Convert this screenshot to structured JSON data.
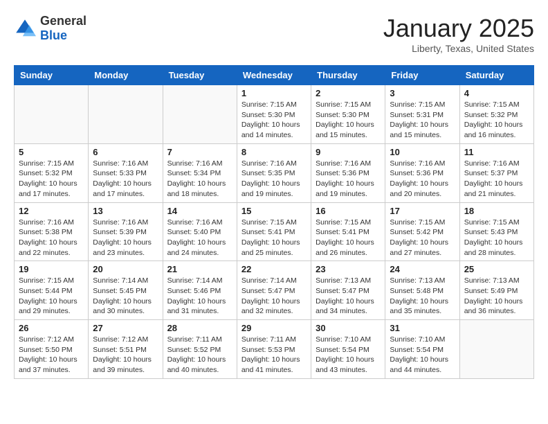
{
  "logo": {
    "general": "General",
    "blue": "Blue"
  },
  "header": {
    "month": "January 2025",
    "location": "Liberty, Texas, United States"
  },
  "weekdays": [
    "Sunday",
    "Monday",
    "Tuesday",
    "Wednesday",
    "Thursday",
    "Friday",
    "Saturday"
  ],
  "weeks": [
    [
      {
        "day": "",
        "info": ""
      },
      {
        "day": "",
        "info": ""
      },
      {
        "day": "",
        "info": ""
      },
      {
        "day": "1",
        "info": "Sunrise: 7:15 AM\nSunset: 5:30 PM\nDaylight: 10 hours\nand 14 minutes."
      },
      {
        "day": "2",
        "info": "Sunrise: 7:15 AM\nSunset: 5:30 PM\nDaylight: 10 hours\nand 15 minutes."
      },
      {
        "day": "3",
        "info": "Sunrise: 7:15 AM\nSunset: 5:31 PM\nDaylight: 10 hours\nand 15 minutes."
      },
      {
        "day": "4",
        "info": "Sunrise: 7:15 AM\nSunset: 5:32 PM\nDaylight: 10 hours\nand 16 minutes."
      }
    ],
    [
      {
        "day": "5",
        "info": "Sunrise: 7:15 AM\nSunset: 5:32 PM\nDaylight: 10 hours\nand 17 minutes."
      },
      {
        "day": "6",
        "info": "Sunrise: 7:16 AM\nSunset: 5:33 PM\nDaylight: 10 hours\nand 17 minutes."
      },
      {
        "day": "7",
        "info": "Sunrise: 7:16 AM\nSunset: 5:34 PM\nDaylight: 10 hours\nand 18 minutes."
      },
      {
        "day": "8",
        "info": "Sunrise: 7:16 AM\nSunset: 5:35 PM\nDaylight: 10 hours\nand 19 minutes."
      },
      {
        "day": "9",
        "info": "Sunrise: 7:16 AM\nSunset: 5:36 PM\nDaylight: 10 hours\nand 19 minutes."
      },
      {
        "day": "10",
        "info": "Sunrise: 7:16 AM\nSunset: 5:36 PM\nDaylight: 10 hours\nand 20 minutes."
      },
      {
        "day": "11",
        "info": "Sunrise: 7:16 AM\nSunset: 5:37 PM\nDaylight: 10 hours\nand 21 minutes."
      }
    ],
    [
      {
        "day": "12",
        "info": "Sunrise: 7:16 AM\nSunset: 5:38 PM\nDaylight: 10 hours\nand 22 minutes."
      },
      {
        "day": "13",
        "info": "Sunrise: 7:16 AM\nSunset: 5:39 PM\nDaylight: 10 hours\nand 23 minutes."
      },
      {
        "day": "14",
        "info": "Sunrise: 7:16 AM\nSunset: 5:40 PM\nDaylight: 10 hours\nand 24 minutes."
      },
      {
        "day": "15",
        "info": "Sunrise: 7:15 AM\nSunset: 5:41 PM\nDaylight: 10 hours\nand 25 minutes."
      },
      {
        "day": "16",
        "info": "Sunrise: 7:15 AM\nSunset: 5:41 PM\nDaylight: 10 hours\nand 26 minutes."
      },
      {
        "day": "17",
        "info": "Sunrise: 7:15 AM\nSunset: 5:42 PM\nDaylight: 10 hours\nand 27 minutes."
      },
      {
        "day": "18",
        "info": "Sunrise: 7:15 AM\nSunset: 5:43 PM\nDaylight: 10 hours\nand 28 minutes."
      }
    ],
    [
      {
        "day": "19",
        "info": "Sunrise: 7:15 AM\nSunset: 5:44 PM\nDaylight: 10 hours\nand 29 minutes."
      },
      {
        "day": "20",
        "info": "Sunrise: 7:14 AM\nSunset: 5:45 PM\nDaylight: 10 hours\nand 30 minutes."
      },
      {
        "day": "21",
        "info": "Sunrise: 7:14 AM\nSunset: 5:46 PM\nDaylight: 10 hours\nand 31 minutes."
      },
      {
        "day": "22",
        "info": "Sunrise: 7:14 AM\nSunset: 5:47 PM\nDaylight: 10 hours\nand 32 minutes."
      },
      {
        "day": "23",
        "info": "Sunrise: 7:13 AM\nSunset: 5:47 PM\nDaylight: 10 hours\nand 34 minutes."
      },
      {
        "day": "24",
        "info": "Sunrise: 7:13 AM\nSunset: 5:48 PM\nDaylight: 10 hours\nand 35 minutes."
      },
      {
        "day": "25",
        "info": "Sunrise: 7:13 AM\nSunset: 5:49 PM\nDaylight: 10 hours\nand 36 minutes."
      }
    ],
    [
      {
        "day": "26",
        "info": "Sunrise: 7:12 AM\nSunset: 5:50 PM\nDaylight: 10 hours\nand 37 minutes."
      },
      {
        "day": "27",
        "info": "Sunrise: 7:12 AM\nSunset: 5:51 PM\nDaylight: 10 hours\nand 39 minutes."
      },
      {
        "day": "28",
        "info": "Sunrise: 7:11 AM\nSunset: 5:52 PM\nDaylight: 10 hours\nand 40 minutes."
      },
      {
        "day": "29",
        "info": "Sunrise: 7:11 AM\nSunset: 5:53 PM\nDaylight: 10 hours\nand 41 minutes."
      },
      {
        "day": "30",
        "info": "Sunrise: 7:10 AM\nSunset: 5:54 PM\nDaylight: 10 hours\nand 43 minutes."
      },
      {
        "day": "31",
        "info": "Sunrise: 7:10 AM\nSunset: 5:54 PM\nDaylight: 10 hours\nand 44 minutes."
      },
      {
        "day": "",
        "info": ""
      }
    ]
  ]
}
